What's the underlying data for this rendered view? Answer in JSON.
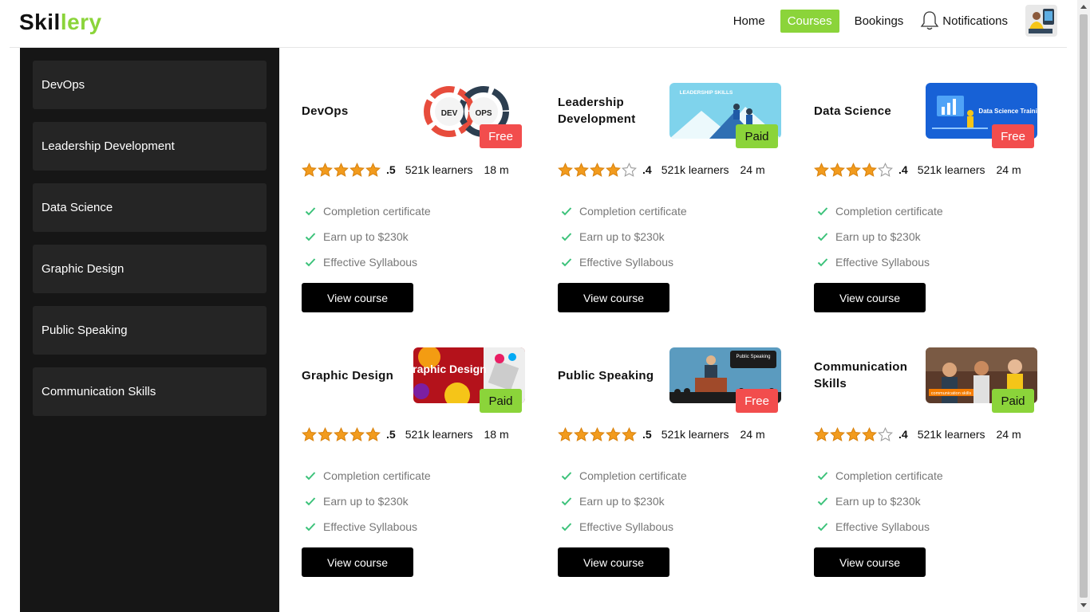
{
  "brand": {
    "part1": "Skil",
    "part2": "lery"
  },
  "nav": {
    "home": "Home",
    "courses": "Courses",
    "bookings": "Bookings",
    "notifications": "Notifications"
  },
  "sidebar": {
    "items": [
      {
        "label": "DevOps"
      },
      {
        "label": "Leadership Development"
      },
      {
        "label": "Data Science"
      },
      {
        "label": "Graphic Design"
      },
      {
        "label": "Public Speaking"
      },
      {
        "label": "Communication Skills"
      }
    ]
  },
  "courses": [
    {
      "title": "DevOps",
      "price": "Free",
      "stars": 5,
      "rating": ".5",
      "learners": "521k learners",
      "duration": "18 m",
      "features": [
        "Completion certificate",
        "Earn up to $230k",
        "Effective Syllabous"
      ],
      "button": "View course"
    },
    {
      "title": "Leadership Development",
      "price": "Paid",
      "stars": 4,
      "rating": ".4",
      "learners": "521k learners",
      "duration": "24 m",
      "features": [
        "Completion certificate",
        "Earn up to $230k",
        "Effective Syllabous"
      ],
      "button": "View course"
    },
    {
      "title": "Data Science",
      "price": "Free",
      "stars": 4,
      "rating": ".4",
      "learners": "521k learners",
      "duration": "24 m",
      "features": [
        "Completion certificate",
        "Earn up to $230k",
        "Effective Syllabous"
      ],
      "button": "View course"
    },
    {
      "title": "Graphic Design",
      "price": "Paid",
      "stars": 5,
      "rating": ".5",
      "learners": "521k learners",
      "duration": "18 m",
      "features": [
        "Completion certificate",
        "Earn up to $230k",
        "Effective Syllabous"
      ],
      "button": "View course"
    },
    {
      "title": "Public Speaking",
      "price": "Free",
      "stars": 5,
      "rating": ".5",
      "learners": "521k learners",
      "duration": "24 m",
      "features": [
        "Completion certificate",
        "Earn up to $230k",
        "Effective Syllabous"
      ],
      "button": "View course"
    },
    {
      "title": "Communication Skills",
      "price": "Paid",
      "stars": 4,
      "rating": ".4",
      "learners": "521k learners",
      "duration": "24 m",
      "features": [
        "Completion certificate",
        "Earn up to $230k",
        "Effective Syllabous"
      ],
      "button": "View course"
    }
  ],
  "thumbnails": {
    "devops": {
      "dev": "DEV",
      "ops": "OPS"
    },
    "leadership": {
      "text": "LEADERSHIP SKILLS"
    },
    "datascience": {
      "text": "Data Science Training"
    },
    "graphic": {
      "text": "Graphic Design"
    },
    "speaking": {
      "text": "Public Speaking"
    },
    "communication": {
      "text": "communication skills"
    }
  },
  "colors": {
    "accent": "#8bd43a",
    "free": "#f24d4d",
    "sidebar": "#161616",
    "star": "#f29b1d",
    "check": "#3cc27a"
  }
}
